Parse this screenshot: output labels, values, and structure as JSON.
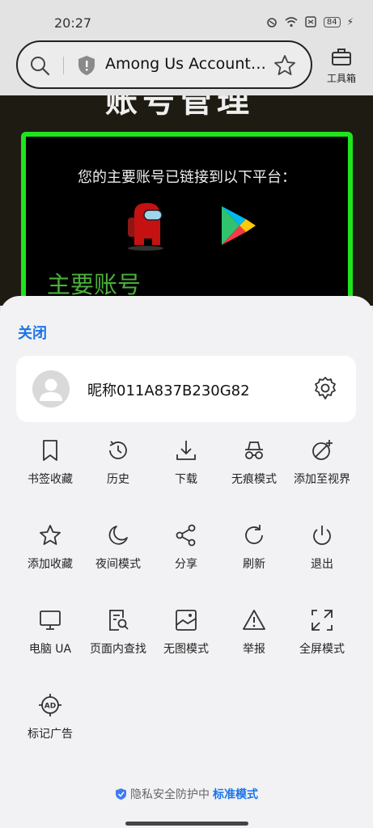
{
  "status": {
    "time": "20:27",
    "battery": "84"
  },
  "address_bar": {
    "title": "Among Us Account…",
    "toolbox_label": "工具箱"
  },
  "page": {
    "heading": "账号管理",
    "linked_text": "您的主要账号已链接到以下平台：",
    "main_account": "主要账号"
  },
  "sheet": {
    "close_label": "关闭",
    "nickname": "昵称011A837B230G82",
    "privacy_text": "隐私安全防护中",
    "privacy_mode": "标准模式"
  },
  "menu": [
    {
      "label": "书签收藏",
      "icon": "bookmark-icon"
    },
    {
      "label": "历史",
      "icon": "history-icon"
    },
    {
      "label": "下载",
      "icon": "download-icon"
    },
    {
      "label": "无痕模式",
      "icon": "incognito-icon"
    },
    {
      "label": "添加至视界",
      "icon": "add-to-view-icon"
    },
    {
      "label": "添加收藏",
      "icon": "star-icon"
    },
    {
      "label": "夜间模式",
      "icon": "moon-icon"
    },
    {
      "label": "分享",
      "icon": "share-icon"
    },
    {
      "label": "刷新",
      "icon": "refresh-icon"
    },
    {
      "label": "退出",
      "icon": "power-icon"
    },
    {
      "label": "电脑 UA",
      "icon": "monitor-icon"
    },
    {
      "label": "页面内查找",
      "icon": "find-in-page-icon"
    },
    {
      "label": "无图模式",
      "icon": "no-image-icon"
    },
    {
      "label": "举报",
      "icon": "warning-icon"
    },
    {
      "label": "全屏模式",
      "icon": "fullscreen-icon"
    },
    {
      "label": "标记广告",
      "icon": "ad-target-icon"
    }
  ],
  "colors": {
    "accent": "#1a73e8",
    "page_border": "#1ee41e",
    "main_account": "#4caf3a"
  }
}
